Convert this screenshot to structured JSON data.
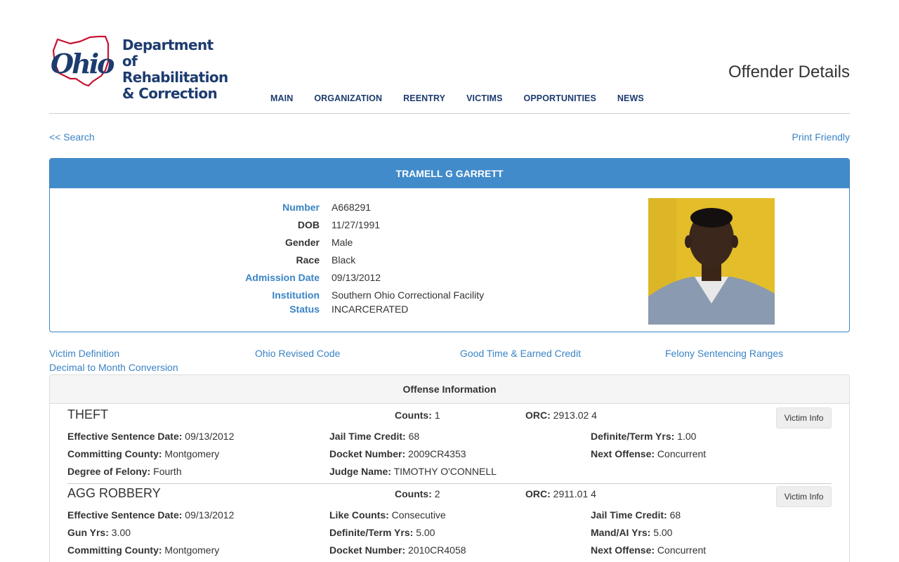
{
  "header": {
    "logo_word": "Ohio",
    "department_lines": [
      "Department of",
      "Rehabilitation",
      "& Correction"
    ],
    "page_title": "Offender Details",
    "nav": [
      "MAIN",
      "ORGANIZATION",
      "REENTRY",
      "VICTIMS",
      "OPPORTUNITIES",
      "NEWS"
    ]
  },
  "links": {
    "search": "<< Search",
    "print": "Print Friendly"
  },
  "offender": {
    "name": "TRAMELL G GARRETT",
    "fields": [
      {
        "label": "Number",
        "value": "A668291",
        "link": true
      },
      {
        "label": "DOB",
        "value": "11/27/1991",
        "link": false
      },
      {
        "label": "Gender",
        "value": "Male",
        "link": false
      },
      {
        "label": "Race",
        "value": "Black",
        "link": false
      },
      {
        "label": "Admission Date",
        "value": "09/13/2012",
        "link": true
      },
      {
        "label": "Institution",
        "value": "Southern Ohio Correctional Facility",
        "link": true
      },
      {
        "label": "Status",
        "value": "INCARCERATED",
        "link": true
      }
    ]
  },
  "reference_links": [
    "Victim Definition",
    "Ohio Revised Code",
    "Good Time & Earned Credit",
    "Felony Sentencing Ranges",
    "Decimal to Month Conversion"
  ],
  "offense_section": {
    "title": "Offense Information",
    "victim_button": "Victim Info",
    "offenses": [
      {
        "name": "THEFT",
        "counts": {
          "label": "Counts:",
          "value": "1"
        },
        "orc": {
          "label": "ORC:",
          "value": "2913.02 4"
        },
        "rows": [
          [
            {
              "label": "Effective Sentence Date:",
              "value": "09/13/2012"
            },
            {
              "label": "Jail Time Credit:",
              "value": "68"
            },
            {
              "label": "Definite/Term Yrs:",
              "value": "1.00"
            }
          ],
          [
            {
              "label": "Committing County:",
              "value": "Montgomery"
            },
            {
              "label": "Docket Number:",
              "value": "2009CR4353"
            },
            {
              "label": "Next Offense:",
              "value": "Concurrent"
            }
          ],
          [
            {
              "label": "Degree of Felony:",
              "value": "Fourth"
            },
            {
              "label": "Judge Name:",
              "value": "TIMOTHY O'CONNELL"
            }
          ]
        ]
      },
      {
        "name": "AGG ROBBERY",
        "counts": {
          "label": "Counts:",
          "value": "2"
        },
        "orc": {
          "label": "ORC:",
          "value": "2911.01 4"
        },
        "rows": [
          [
            {
              "label": "Effective Sentence Date:",
              "value": "09/13/2012"
            },
            {
              "label": "Like Counts:",
              "value": "Consecutive"
            },
            {
              "label": "Jail Time Credit:",
              "value": "68"
            }
          ],
          [
            {
              "label": "Gun Yrs:",
              "value": "3.00"
            },
            {
              "label": "Definite/Term Yrs:",
              "value": "5.00"
            },
            {
              "label": "Mand/AI Yrs:",
              "value": "5.00"
            }
          ],
          [
            {
              "label": "Committing County:",
              "value": "Montgomery"
            },
            {
              "label": "Docket Number:",
              "value": "2010CR4058"
            },
            {
              "label": "Next Offense:",
              "value": "Concurrent"
            }
          ]
        ]
      }
    ]
  },
  "colors": {
    "link": "#3a83c5",
    "panel_header": "#428bca",
    "brand_navy": "#1d3c6e",
    "brand_red": "#c8102e"
  },
  "icons": {
    "logo": "ohio-state-outline-logo",
    "photo": "offender-photo"
  }
}
